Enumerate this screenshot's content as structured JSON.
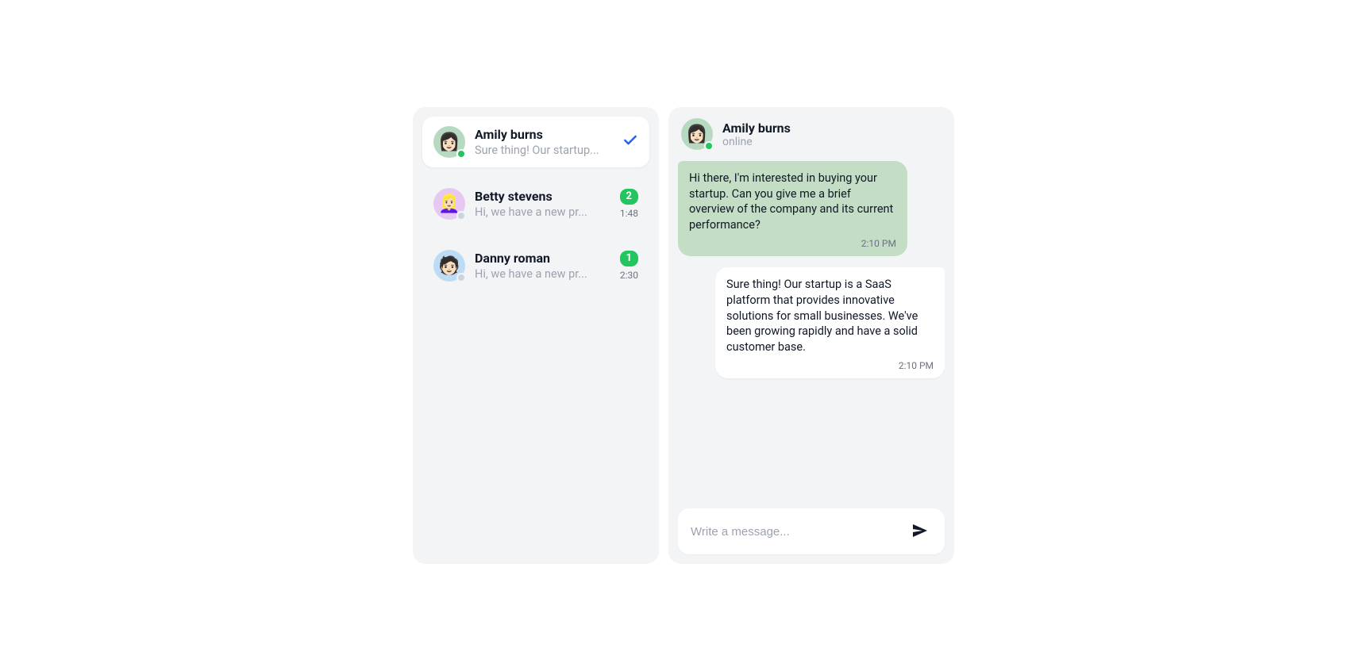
{
  "sidebar": {
    "contacts": [
      {
        "name": "Amily burns",
        "preview": "Sure thing! Our startup...",
        "avatar_bg": "#b7d9c2",
        "avatar_emoji": "👩🏻",
        "status": "online",
        "selected": true,
        "unread": null,
        "time": null,
        "read": true
      },
      {
        "name": "Betty stevens",
        "preview": "Hi, we have a new pr...",
        "avatar_bg": "#e7c8f2",
        "avatar_emoji": "👱🏻‍♀️",
        "status": "offline",
        "selected": false,
        "unread": "2",
        "time": "1:48",
        "read": false
      },
      {
        "name": "Danny roman",
        "preview": "Hi, we have a new pr...",
        "avatar_bg": "#bcdcf5",
        "avatar_emoji": "🧑🏻",
        "status": "offline",
        "selected": false,
        "unread": "1",
        "time": "2:30",
        "read": false
      }
    ]
  },
  "chat": {
    "header": {
      "name": "Amily burns",
      "status_text": "online",
      "avatar_bg": "#b7d9c2",
      "avatar_emoji": "👩🏻",
      "status": "online"
    },
    "messages": [
      {
        "direction": "in",
        "text": "Hi there, I'm interested in buying your startup. Can you give me a brief overview of the company and its current performance?",
        "time": "2:10 PM"
      },
      {
        "direction": "out",
        "text": "Sure thing! Our startup is a SaaS platform that provides innovative solutions for small businesses. We've been growing rapidly and have a solid customer base.",
        "time": "2:10 PM"
      }
    ],
    "composer": {
      "placeholder": "Write a message...",
      "value": ""
    }
  }
}
